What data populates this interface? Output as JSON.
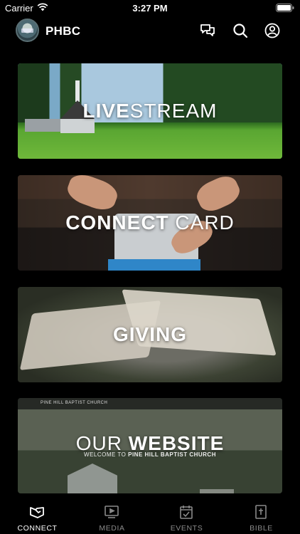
{
  "status_bar": {
    "carrier": "Carrier",
    "time": "3:27 PM"
  },
  "header": {
    "title": "PHBC"
  },
  "cards": {
    "livestream": {
      "bold": "LIVE",
      "light": "STREAM"
    },
    "connect": {
      "bold": "CONNECT",
      "light": " CARD"
    },
    "giving": {
      "bold": "GIVING",
      "light": ""
    },
    "website": {
      "light": "OUR ",
      "bold": "WEBSITE",
      "site_brand": "PINE HILL BAPTIST CHURCH",
      "site_welcome": "WELCOME TO ",
      "site_welcome_bold": "PINE HILL BAPTIST CHURCH"
    }
  },
  "tabs": [
    {
      "label": "CONNECT",
      "icon": "connect-icon",
      "active": true
    },
    {
      "label": "MEDIA",
      "icon": "media-icon",
      "active": false
    },
    {
      "label": "EVENTS",
      "icon": "events-icon",
      "active": false
    },
    {
      "label": "BIBLE",
      "icon": "bible-icon",
      "active": false
    }
  ],
  "colors": {
    "background": "#000000",
    "active_tab": "#ffffff",
    "inactive_tab": "#8a8a8a"
  }
}
